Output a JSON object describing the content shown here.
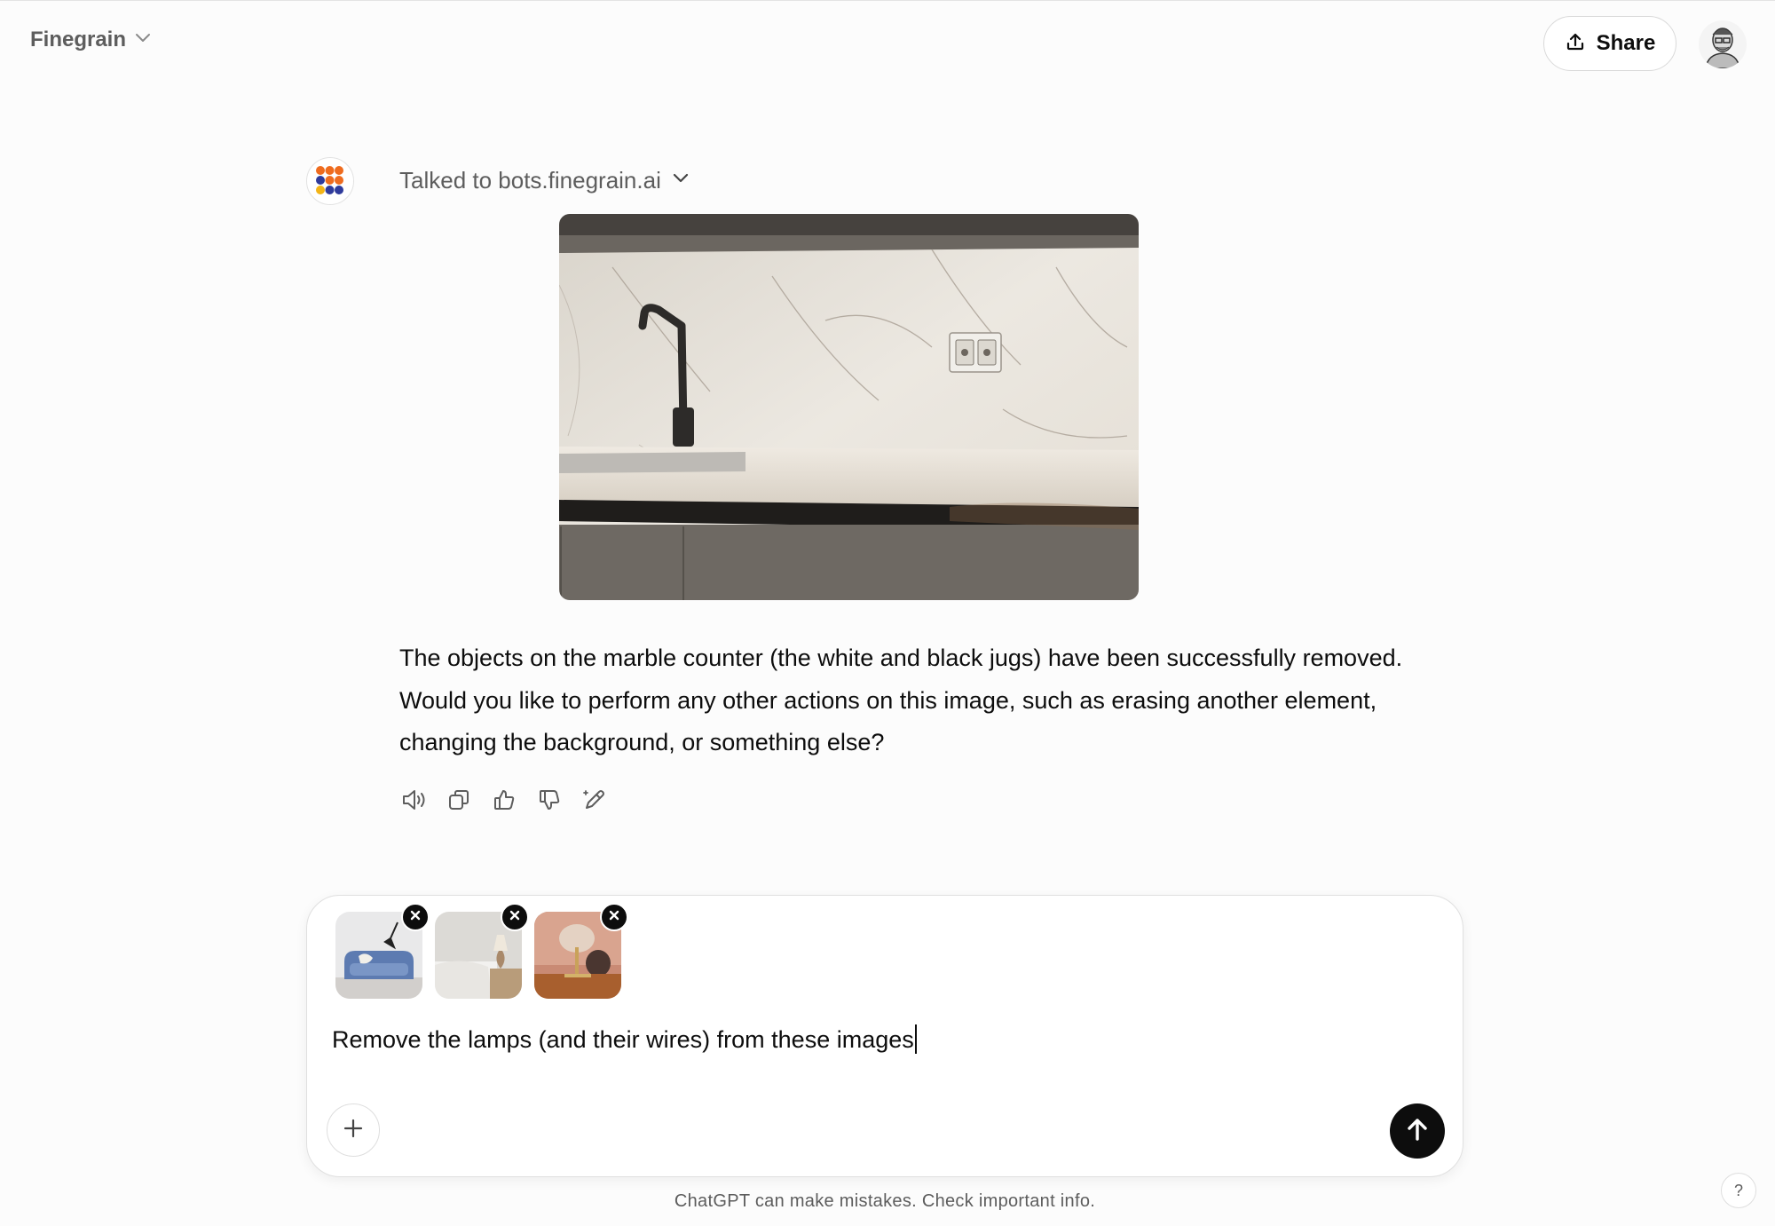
{
  "header": {
    "model_name": "Finegrain",
    "share_label": "Share"
  },
  "message": {
    "tool_status": "Talked to bots.finegrain.ai",
    "reply_paragraph_1": "The objects on the marble counter (the white and black jugs) have been successfully removed.",
    "reply_paragraph_2": "Would you like to perform any other actions on this image, such as erasing another element,",
    "reply_paragraph_3": "changing the background, or something else?"
  },
  "composer": {
    "prompt_text": "Remove the lamps (and their wires) from these images",
    "attachments": [
      "blue-sofa-image",
      "bedroom-lamp-image",
      "glass-lamp-image"
    ]
  },
  "footer": {
    "disclaimer": "ChatGPT can make mistakes. Check important info.",
    "help_label": "?"
  },
  "colors": {
    "background": "#fcfcfc",
    "text_primary": "#0d0d0d",
    "text_secondary": "#5d5d5d",
    "send_button": "#0d0d0d",
    "logo_orange": "#ef6c1f",
    "logo_blue": "#2f3b9c",
    "logo_yellow": "#f3b417"
  }
}
